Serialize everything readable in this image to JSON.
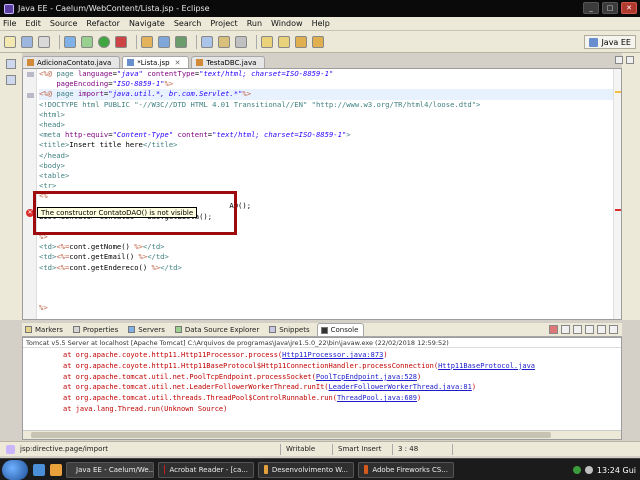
{
  "window": {
    "title": "Java EE - Caelum/WebContent/Lista.jsp - Eclipse"
  },
  "menu": [
    "File",
    "Edit",
    "Source",
    "Refactor",
    "Navigate",
    "Search",
    "Project",
    "Run",
    "Window",
    "Help"
  ],
  "perspective": {
    "label": "Java EE"
  },
  "editor_tabs": [
    {
      "label": "AdicionaContato.java",
      "active": false
    },
    {
      "label": "*Lista.jsp",
      "active": true
    },
    {
      "label": "TestaDBC.java",
      "active": false
    }
  ],
  "tooltip": "The constructor ContatoDAO() is not visible",
  "code_lines": [
    {
      "parts": [
        [
          "jsp",
          "<%@ "
        ],
        [
          "tagc",
          "page "
        ],
        [
          "attr",
          "language"
        ],
        [
          "",
          "="
        ],
        [
          "str",
          "\"java\""
        ],
        [
          "",
          ""
        ],
        [
          "attr",
          " contentType"
        ],
        [
          "",
          "="
        ],
        [
          "str",
          "\"text/html; charset=ISO-8859-1\""
        ]
      ]
    },
    {
      "parts": [
        [
          "",
          "    "
        ],
        [
          "attr",
          "pageEncoding"
        ],
        [
          "",
          "="
        ],
        [
          "str",
          "\"ISO-8859-1\""
        ],
        [
          "jsp",
          "%>"
        ]
      ]
    },
    {
      "parts": [
        [
          "jsp",
          "<%@ "
        ],
        [
          "tagc",
          "page "
        ],
        [
          "attr",
          "import"
        ],
        [
          "",
          "="
        ],
        [
          "str",
          "\"java.util.*, br.com.Servlet.*\""
        ],
        [
          "jsp",
          "%>"
        ]
      ]
    },
    {
      "parts": [
        [
          "tagc",
          "<!DOCTYPE html PUBLIC \"-//W3C//DTD HTML 4.01 Transitional//EN\" \"http://www.w3.org/TR/html4/loose.dtd\">"
        ]
      ]
    },
    {
      "parts": [
        [
          "tagc",
          "<html>"
        ]
      ]
    },
    {
      "parts": [
        [
          "tagc",
          "<head>"
        ]
      ]
    },
    {
      "parts": [
        [
          "tagc",
          "<meta "
        ],
        [
          "attr",
          "http-equiv"
        ],
        [
          "",
          "="
        ],
        [
          "str",
          "\"Content-Type\""
        ],
        [
          "attr",
          " content"
        ],
        [
          "",
          "="
        ],
        [
          "str",
          "\"text/html; charset=ISO-8859-1\""
        ],
        [
          "tagc",
          ">"
        ]
      ]
    },
    {
      "parts": [
        [
          "tagc",
          "<title>"
        ],
        [
          "",
          "Insert title here"
        ],
        [
          "tagc",
          "</title>"
        ]
      ]
    },
    {
      "parts": [
        [
          "tagc",
          "</head>"
        ]
      ]
    },
    {
      "parts": [
        [
          "tagc",
          "<body>"
        ]
      ]
    },
    {
      "parts": [
        [
          "tagc",
          "<table>"
        ]
      ]
    },
    {
      "parts": [
        [
          "tagc",
          "<tr>"
        ]
      ]
    },
    {
      "parts": [
        [
          "jsp",
          "<%"
        ]
      ]
    },
    {
      "parts": [
        [
          "",
          "                                            AO();"
        ]
      ]
    },
    {
      "parts": [
        [
          "",
          "List<Contato> contatos = dao.getLista();"
        ]
      ]
    },
    {
      "parts": [
        [
          "",
          ""
        ]
      ]
    },
    {
      "parts": [
        [
          "jsp",
          "%>"
        ]
      ]
    },
    {
      "parts": [
        [
          "tagc",
          "<td>"
        ],
        [
          "jsp",
          "<%="
        ],
        [
          "",
          "cont.getNome() "
        ],
        [
          "jsp",
          "%>"
        ],
        [
          "tagc",
          "</td>"
        ]
      ]
    },
    {
      "parts": [
        [
          "tagc",
          "<td>"
        ],
        [
          "jsp",
          "<%="
        ],
        [
          "",
          "cont.getEmail() "
        ],
        [
          "jsp",
          "%>"
        ],
        [
          "tagc",
          "</td>"
        ]
      ]
    },
    {
      "parts": [
        [
          "tagc",
          "<td>"
        ],
        [
          "jsp",
          "<%="
        ],
        [
          "",
          "cont.getEndereco() "
        ],
        [
          "jsp",
          "%>"
        ],
        [
          "tagc",
          "</td>"
        ]
      ]
    },
    {
      "parts": [
        [
          "",
          ""
        ]
      ]
    },
    {
      "parts": [
        [
          "",
          ""
        ]
      ]
    },
    {
      "parts": [
        [
          "",
          ""
        ]
      ]
    },
    {
      "parts": [
        [
          "jsp",
          "%>"
        ]
      ]
    }
  ],
  "bottom_tabs": [
    "Markers",
    "Properties",
    "Servers",
    "Data Source Explorer",
    "Snippets",
    "Console"
  ],
  "console": {
    "header": "Tomcat v5.5 Server at localhost [Apache Tomcat] C:\\Arquivos de programas\\Java\\jre1.5.0_22\\bin\\javaw.exe (22/02/2018 12:59:52)",
    "lines": [
      {
        "text": "at org.apache.coyote.http11.Http11Processor.process(",
        "link": "Http11Processor.java:873",
        "end": ")"
      },
      {
        "text": "at org.apache.coyote.http11.Http11BaseProtocol$Http11ConnectionHandler.processConnection(",
        "link": "Http11BaseProtocol.java",
        "end": ""
      },
      {
        "text": "at org.apache.tomcat.util.net.PoolTcpEndpoint.processSocket(",
        "link": "PoolTcpEndpoint.java:528",
        "end": ")"
      },
      {
        "text": "at org.apache.tomcat.util.net.LeaderFollowerWorkerThread.runIt(",
        "link": "LeaderFollowerWorkerThread.java:81",
        "end": ")"
      },
      {
        "text": "at org.apache.tomcat.util.threads.ThreadPool$ControlRunnable.run(",
        "link": "ThreadPool.java:689",
        "end": ")"
      },
      {
        "text": "at java.lang.Thread.run(Unknown Source)",
        "link": "",
        "end": ""
      }
    ]
  },
  "status": {
    "left": "jsp:directive.page/import",
    "mode": "Writable",
    "insert": "Smart Insert",
    "position": "3 : 48"
  },
  "taskbar": {
    "tasks": [
      "Java EE - Caelum/We...",
      "Acrobat Reader - [ca...",
      "Desenvolvimento W...",
      "Adobe Fireworks CS..."
    ],
    "clock": "13:24",
    "user": "Gui"
  }
}
